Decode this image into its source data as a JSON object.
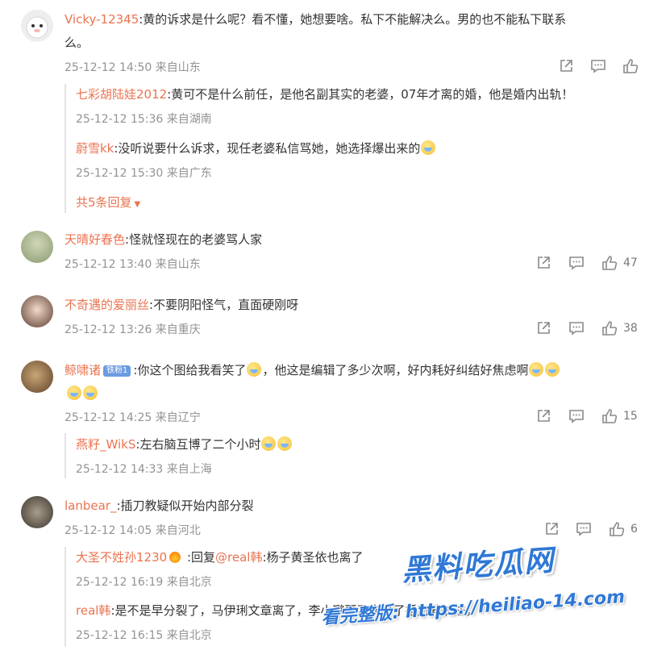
{
  "comments": [
    {
      "user": "Vicky-12345",
      "text": ":黄的诉求是什么呢？看不懂，她想要啥。私下不能解决么。男的也不能私下联系",
      "text2": "么。",
      "meta": "25-12-12 14:50 来自山东",
      "likes": "",
      "replies": [
        {
          "user": "七彩胡陆娃2012",
          "text": ":黄可不是什么前任，是他名副其实的老婆，07年才离的婚，他是婚内出轨！",
          "meta": "25-12-12 15:36 来自湖南"
        },
        {
          "user": "蔚雪kk",
          "text": ":没听说要什么诉求，现任老婆私信骂她，她选择爆出来的",
          "meta": "25-12-12 15:30 来自广东"
        }
      ],
      "more_replies": "共5条回复"
    },
    {
      "user": "天晴好春色",
      "text": ":怪就怪现在的老婆骂人家",
      "meta": "25-12-12 13:40 来自山东",
      "likes": "47"
    },
    {
      "user": "不奇遇的爱丽丝",
      "text": ":不要阴阳怪气，直面硬刚呀",
      "meta": "25-12-12 13:26 来自重庆",
      "likes": "38"
    },
    {
      "user": "鲸啸诸",
      "badge": "铁粉1",
      "text": ":你这个图给我看笑了",
      "text_b": "，他这是编辑了多少次啊，好内耗好纠结好焦虑啊",
      "meta": "25-12-12 14:25 来自辽宁",
      "likes": "15",
      "replies": [
        {
          "user": "燕籽_WikS",
          "text": ":左右脑互博了二个小时",
          "meta": "25-12-12 14:33 来自上海"
        }
      ]
    },
    {
      "user": "lanbear_",
      "text": ":插刀教疑似开始内部分裂",
      "meta": "25-12-12 14:05 来自河北",
      "likes": "6",
      "replies": [
        {
          "user": "大圣不姓孙1230",
          "text": " :回复",
          "mention": "@real韩",
          "text_b": ":杨子黄圣依也离了",
          "meta": "25-12-12 16:19 来自北京"
        },
        {
          "user": "real韩",
          "text": ":是不是早分裂了，马伊琍文章离了，李小璐贾乃亮离了",
          "text_b": "插刀教护法。",
          "meta": "25-12-12 16:15 来自北京"
        }
      ]
    }
  ],
  "watermark": {
    "line1": "黑料吃瓜网",
    "line2": "看完整版: https://heiliao-14.com"
  },
  "icons": {
    "share": "share-icon",
    "comment": "comment-icon",
    "like": "like-icon",
    "avatar": "avatar"
  },
  "colors": {
    "username": "#eb7350",
    "meta": "#939393",
    "watermark": "#2f78d6"
  }
}
